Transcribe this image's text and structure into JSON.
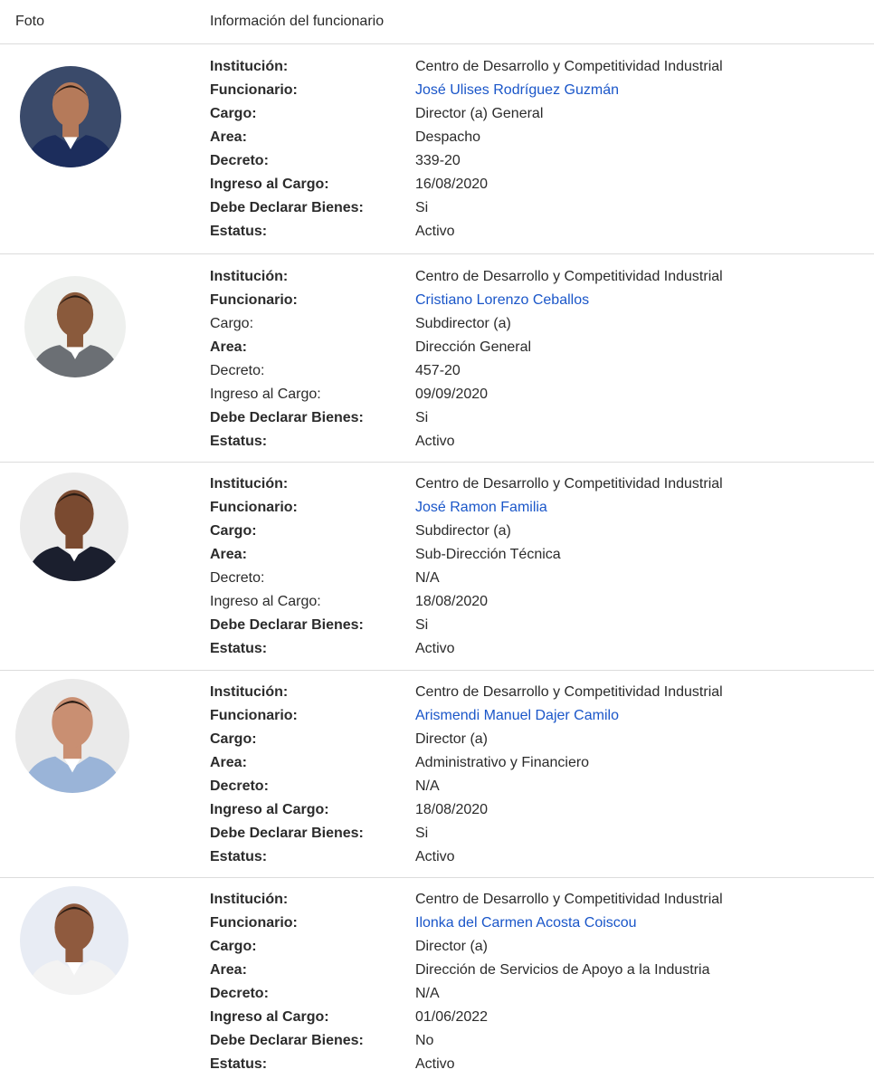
{
  "header": {
    "photo": "Foto",
    "info": "Información del funcionario"
  },
  "labels": {
    "institucion": "Institución:",
    "funcionario": "Funcionario:",
    "cargo": "Cargo:",
    "area": "Area:",
    "decreto": "Decreto:",
    "ingreso": "Ingreso al Cargo:",
    "declarar": "Debe Declarar Bienes:",
    "estatus": "Estatus:"
  },
  "rows": [
    {
      "institucion": "Centro de Desarrollo y Competitividad Industrial",
      "funcionario": "José Ulises Rodríguez Guzmán",
      "cargo": "Director (a) General",
      "area": "Despacho",
      "decreto": "339-20",
      "ingreso": "16/08/2020",
      "declarar": "Si",
      "estatus": "Activo",
      "suit_color": "#1c2d5c",
      "skin_color": "#b57a5a",
      "bg_color": "#3a4a6a"
    },
    {
      "institucion": "Centro de Desarrollo y Competitividad Industrial",
      "funcionario": "Cristiano Lorenzo Ceballos",
      "cargo": "Subdirector (a)",
      "area": "Dirección General",
      "decreto": "457-20",
      "ingreso": "09/09/2020",
      "declarar": "Si",
      "estatus": "Activo",
      "suit_color": "#6b6f74",
      "skin_color": "#8a5a3c",
      "bg_color": "#eef0ee"
    },
    {
      "institucion": "Centro de Desarrollo y Competitividad Industrial",
      "funcionario": "José Ramon Familia",
      "cargo": "Subdirector (a)",
      "area": "Sub-Dirección Técnica",
      "decreto": "N/A",
      "ingreso": "18/08/2020",
      "declarar": "Si",
      "estatus": "Activo",
      "suit_color": "#1b1f2e",
      "skin_color": "#7a4a30",
      "bg_color": "#ececec"
    },
    {
      "institucion": "Centro de Desarrollo y Competitividad Industrial",
      "funcionario": "Arismendi Manuel Dajer Camilo",
      "cargo": "Director (a)",
      "area": "Administrativo y Financiero",
      "decreto": "N/A",
      "ingreso": "18/08/2020",
      "declarar": "Si",
      "estatus": "Activo",
      "suit_color": "#9ab4d8",
      "skin_color": "#c98f72",
      "bg_color": "#eaeaea"
    },
    {
      "institucion": "Centro de Desarrollo y Competitividad Industrial",
      "funcionario": "Ilonka del Carmen Acosta Coiscou",
      "cargo": "Director (a)",
      "area": "Dirección de Servicios de Apoyo a la Industria",
      "decreto": "N/A",
      "ingreso": "01/06/2022",
      "declarar": "No",
      "estatus": "Activo",
      "suit_color": "#f3f3f3",
      "skin_color": "#8f5a3e",
      "bg_color": "#e8ecf4"
    }
  ],
  "colors": {
    "link": "#1a56c9",
    "divider": "#dcdcdc",
    "text": "#2b2b2b"
  }
}
